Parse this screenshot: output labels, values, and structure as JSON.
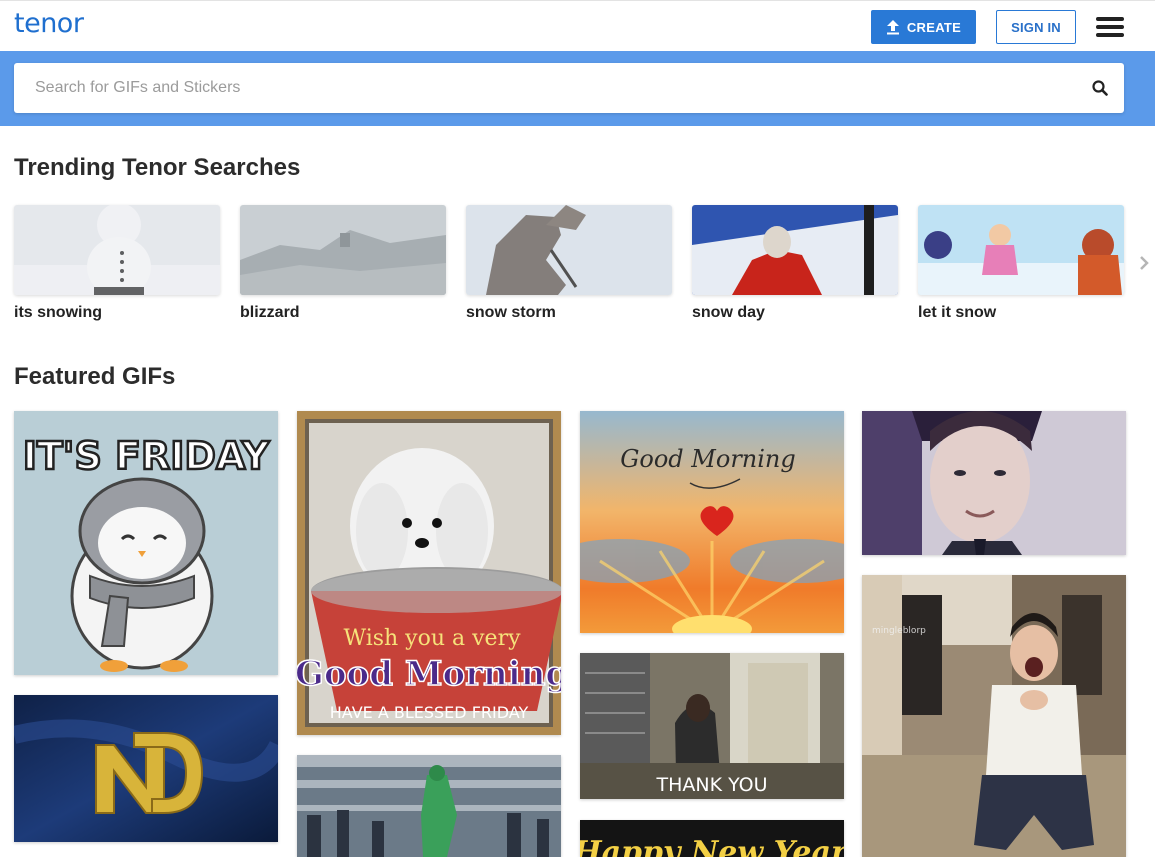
{
  "header": {
    "logo_text": "tenor",
    "create_label": "CREATE",
    "signin_label": "SIGN IN",
    "menu_icon": "hamburger-menu-icon",
    "accent_color": "#2979d6"
  },
  "search": {
    "placeholder": "Search for GIFs and Stickers",
    "value": "",
    "band_color": "#5b9aea"
  },
  "trending": {
    "title": "Trending Tenor Searches",
    "items": [
      {
        "label": "its snowing"
      },
      {
        "label": "blizzard"
      },
      {
        "label": "snow storm"
      },
      {
        "label": "snow day"
      },
      {
        "label": "let it snow"
      }
    ]
  },
  "featured": {
    "title": "Featured GIFs",
    "gifs": {
      "friday_penguin": {
        "text": "IT'S FRIDAY"
      },
      "good_morning_dog": {
        "line1": "Wish you a very",
        "line2": "Good Morning",
        "line3": "HAVE A BLESSED FRIDAY"
      },
      "good_morning_sunrise": {
        "text": "Good Morning"
      },
      "thank_you": {
        "text": "THANK YOU"
      },
      "happy_new_year": {
        "text": "Happy New Year"
      },
      "watermark": {
        "text": "mingleblorp"
      }
    }
  }
}
